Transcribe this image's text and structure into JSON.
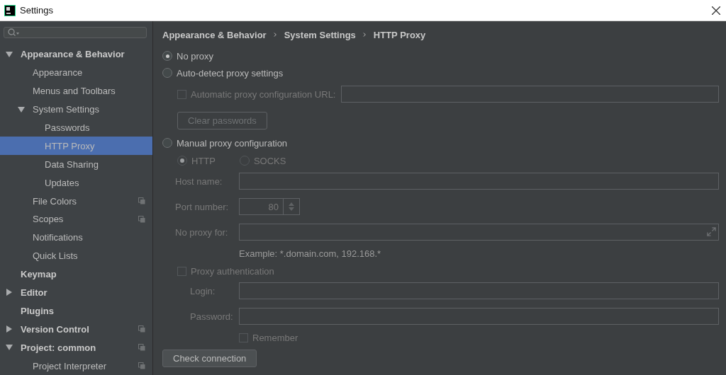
{
  "window": {
    "title": "Settings"
  },
  "tree": [
    {
      "label": "Appearance & Behavior",
      "bold": true,
      "expanded": true,
      "selected": false,
      "shared": false,
      "children": [
        {
          "label": "Appearance",
          "bold": false,
          "selected": false,
          "shared": false
        },
        {
          "label": "Menus and Toolbars",
          "bold": false,
          "selected": false,
          "shared": false
        },
        {
          "label": "System Settings",
          "bold": false,
          "expanded": true,
          "selected": false,
          "shared": false,
          "children": [
            {
              "label": "Passwords",
              "bold": false,
              "selected": false,
              "shared": false
            },
            {
              "label": "HTTP Proxy",
              "bold": false,
              "selected": true,
              "shared": false
            },
            {
              "label": "Data Sharing",
              "bold": false,
              "selected": false,
              "shared": false
            },
            {
              "label": "Updates",
              "bold": false,
              "selected": false,
              "shared": false
            }
          ]
        },
        {
          "label": "File Colors",
          "bold": false,
          "selected": false,
          "shared": true
        },
        {
          "label": "Scopes",
          "bold": false,
          "selected": false,
          "shared": true
        },
        {
          "label": "Notifications",
          "bold": false,
          "selected": false,
          "shared": false
        },
        {
          "label": "Quick Lists",
          "bold": false,
          "selected": false,
          "shared": false
        }
      ]
    },
    {
      "label": "Keymap",
      "bold": true,
      "selected": false,
      "shared": false
    },
    {
      "label": "Editor",
      "bold": true,
      "expanded": false,
      "selected": false,
      "shared": false
    },
    {
      "label": "Plugins",
      "bold": true,
      "selected": false,
      "shared": false
    },
    {
      "label": "Version Control",
      "bold": true,
      "expanded": false,
      "selected": false,
      "shared": true
    },
    {
      "label": "Project: common",
      "bold": true,
      "expanded": true,
      "selected": false,
      "shared": true,
      "children": [
        {
          "label": "Project Interpreter",
          "bold": false,
          "selected": false,
          "shared": true
        }
      ]
    }
  ],
  "breadcrumb": [
    "Appearance & Behavior",
    "System Settings",
    "HTTP Proxy"
  ],
  "no_proxy": {
    "label": "No proxy",
    "selected": true
  },
  "auto_detect": {
    "label": "Auto-detect proxy settings",
    "selected": false,
    "pac_url": {
      "label": "Automatic proxy configuration URL:",
      "checked": false,
      "disabled": true
    },
    "clear_passwords": {
      "label": "Clear passwords",
      "disabled": true
    }
  },
  "manual": {
    "label": "Manual proxy configuration",
    "selected": false,
    "protocols": [
      {
        "label": "HTTP",
        "selected": true,
        "disabled": true
      },
      {
        "label": "SOCKS",
        "selected": false,
        "disabled": true
      }
    ],
    "fields": [
      {
        "kind": "text",
        "label": "Host name:",
        "disabled": true
      },
      {
        "kind": "spinner",
        "label": "Port number:",
        "value": "80",
        "disabled": true
      },
      {
        "kind": "expandable",
        "label": "No proxy for:",
        "disabled": true
      }
    ],
    "example": "Example: *.domain.com, 192.168.*",
    "auth": {
      "label": "Proxy authentication",
      "checked": false,
      "disabled": true,
      "fields": [
        {
          "kind": "text",
          "label": "Login:",
          "disabled": true
        },
        {
          "kind": "text",
          "label": "Password:",
          "disabled": true
        }
      ],
      "remember": {
        "label": "Remember",
        "checked": false,
        "disabled": true
      }
    }
  },
  "check_button": "Check connection"
}
